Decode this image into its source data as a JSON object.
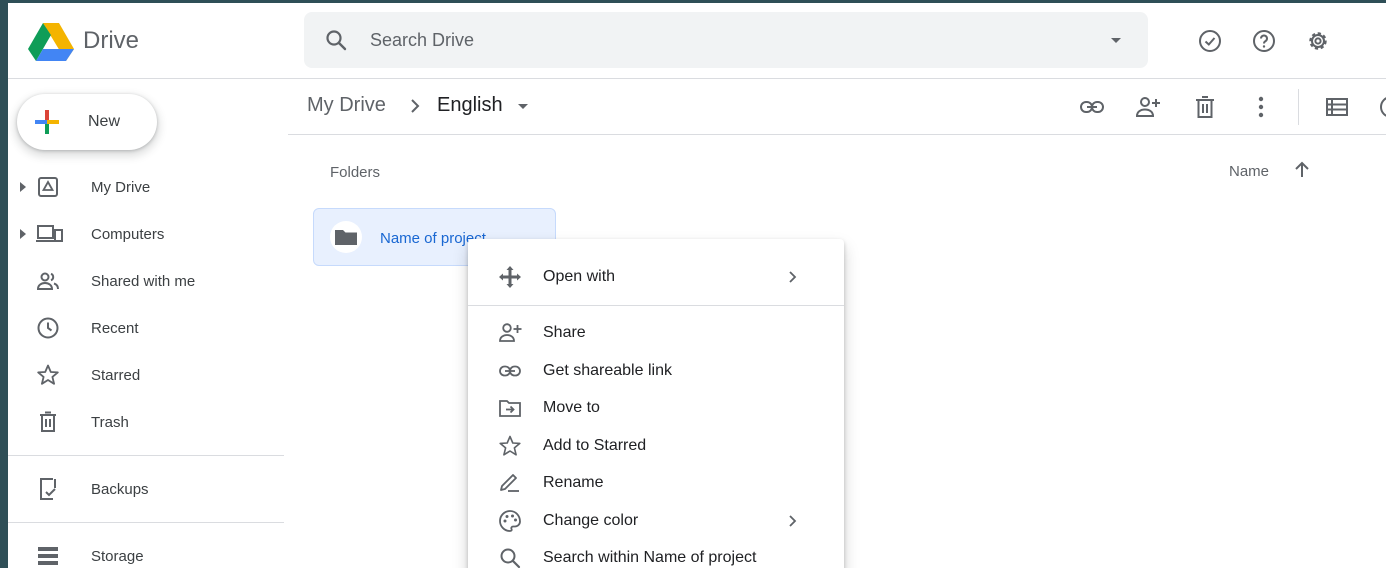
{
  "app": {
    "name": "Drive"
  },
  "search": {
    "placeholder": "Search Drive"
  },
  "header_icons": [
    "check-circle-icon",
    "help-icon",
    "settings-icon"
  ],
  "sidebar": {
    "new_label": "New",
    "items": [
      {
        "label": "My Drive",
        "icon": "my-drive-icon",
        "expandable": true
      },
      {
        "label": "Computers",
        "icon": "computers-icon",
        "expandable": true
      },
      {
        "label": "Shared with me",
        "icon": "people-icon",
        "expandable": false
      },
      {
        "label": "Recent",
        "icon": "clock-icon",
        "expandable": false
      },
      {
        "label": "Starred",
        "icon": "star-icon",
        "expandable": false
      },
      {
        "label": "Trash",
        "icon": "trash-icon",
        "expandable": false
      },
      {
        "label": "Backups",
        "icon": "backup-icon",
        "expandable": false
      },
      {
        "label": "Storage",
        "icon": "storage-icon",
        "expandable": false
      }
    ]
  },
  "breadcrumb": {
    "root": "My Drive",
    "current": "English"
  },
  "toolbar_icons": [
    "link-icon",
    "add-person-icon",
    "trash-icon",
    "more-vert-icon",
    "list-view-icon",
    "info-icon"
  ],
  "main": {
    "section_label": "Folders",
    "sort_label": "Name",
    "folders": [
      {
        "name": "Name of project"
      }
    ]
  },
  "context_menu": {
    "items": [
      {
        "label": "Open with",
        "icon": "open-with-icon",
        "submenu": true
      },
      {
        "label": "Share",
        "icon": "add-person-icon",
        "submenu": false
      },
      {
        "label": "Get shareable link",
        "icon": "link-icon",
        "submenu": false
      },
      {
        "label": "Move to",
        "icon": "move-to-icon",
        "submenu": false
      },
      {
        "label": "Add to Starred",
        "icon": "star-icon",
        "submenu": false
      },
      {
        "label": "Rename",
        "icon": "rename-icon",
        "submenu": false
      },
      {
        "label": "Change color",
        "icon": "palette-icon",
        "submenu": true
      },
      {
        "label": "Search within Name of project",
        "icon": "search-icon",
        "submenu": false
      }
    ]
  },
  "colors": {
    "accent": "#1967d2",
    "selected_bg": "#e8f0fe",
    "frame": "#2f4f57",
    "drive_green": "#0f9d58",
    "drive_yellow": "#f4b400",
    "drive_blue": "#4285f4",
    "drive_red": "#db4437"
  }
}
